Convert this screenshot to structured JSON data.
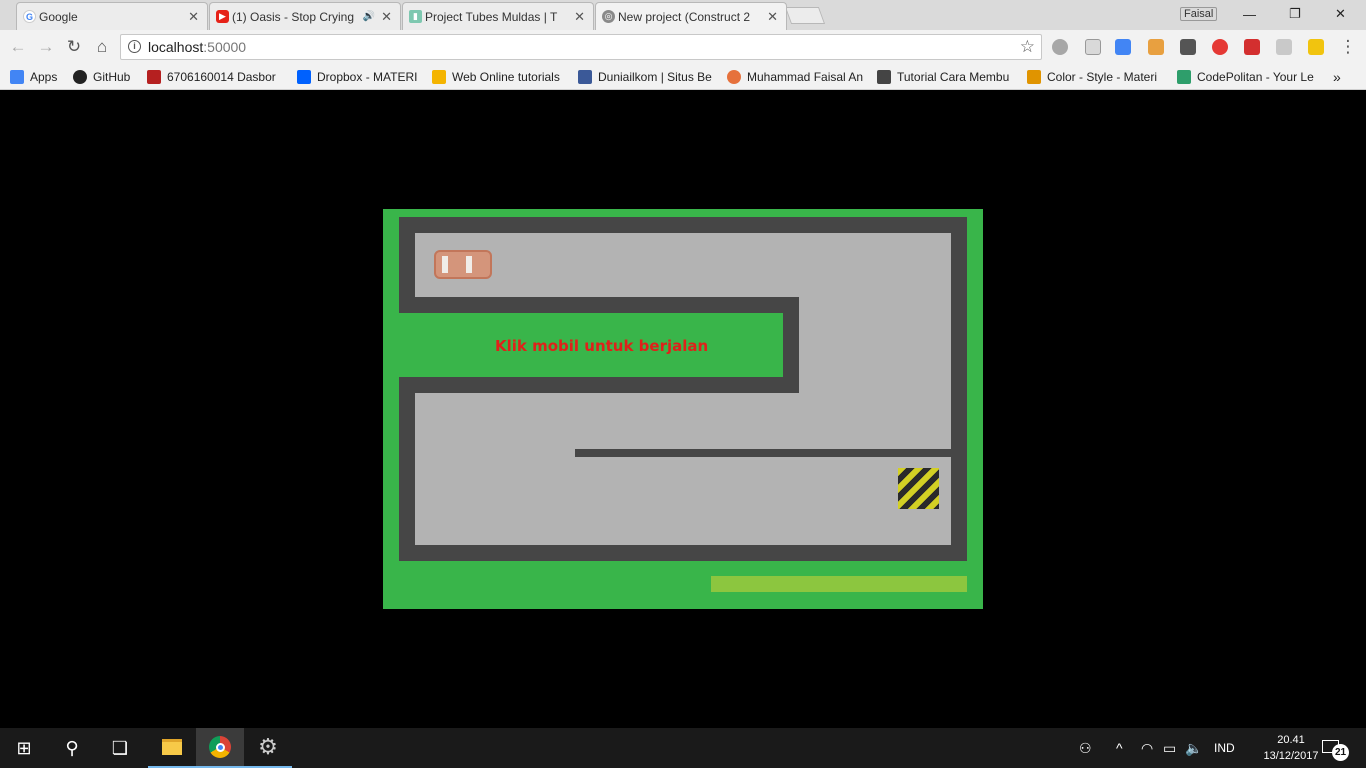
{
  "browser": {
    "tabs": [
      {
        "title": "Google",
        "favicon_color": "#4285f4",
        "favicon": "G"
      },
      {
        "title": "(1) Oasis - Stop Crying",
        "favicon_color": "#e62117",
        "favicon": "▶"
      },
      {
        "title": "Project Tubes Muldas | T",
        "favicon_color": "#7ec8b0",
        "favicon": "▮"
      },
      {
        "title": "New project (Construct 2",
        "favicon_color": "#8a8a8a",
        "favicon": "◎"
      }
    ],
    "close_glyph": "✕",
    "audio_glyph": "🔊",
    "profile_name": "Faisal",
    "window_controls": {
      "minimize": "—",
      "maximize": "❐",
      "close": "✕"
    },
    "nav": {
      "back": "←",
      "forward": "→",
      "reload": "↻",
      "home": "⌂"
    },
    "address": {
      "host": "localhost",
      "port": ":50000"
    },
    "star_glyph": "☆",
    "menu_glyph": "⋮",
    "bookmarks": [
      {
        "label": "Apps",
        "color": "#4285f4"
      },
      {
        "label": "GitHub",
        "color": "#222222"
      },
      {
        "label": "6706160014 Dasbor",
        "color": "#b52020"
      },
      {
        "label": "Dropbox - MATERI",
        "color": "#0061fe"
      },
      {
        "label": "Web Online tutorials",
        "color": "#f4b400"
      },
      {
        "label": "Duniailkom | Situs Be",
        "color": "#3b5998"
      },
      {
        "label": "Muhammad Faisal An",
        "color": "#e6713c"
      },
      {
        "label": "Tutorial Cara Membu",
        "color": "#444444"
      },
      {
        "label": "Color - Style - Materi",
        "color": "#e09400"
      },
      {
        "label": "CodePolitan - Your Le",
        "color": "#2e9e6b"
      }
    ],
    "bookmarks_overflow": "»"
  },
  "game": {
    "message": "Klik mobil untuk berjalan",
    "colors": {
      "grass": "#39b54a",
      "wall": "#464646",
      "road": "#b3b3b3",
      "text": "#e0211a",
      "progress": "#8cc63f"
    }
  },
  "taskbar": {
    "start_glyph": "⊞",
    "search_glyph": "⚲",
    "taskview_glyph": "❏",
    "tray": {
      "people": "⚇",
      "chevron": "^",
      "wifi": "◠",
      "battery": "▭",
      "volume": "🔈",
      "language": "IND"
    },
    "time": "20.41",
    "date": "13/12/2017",
    "notifications": "21"
  }
}
